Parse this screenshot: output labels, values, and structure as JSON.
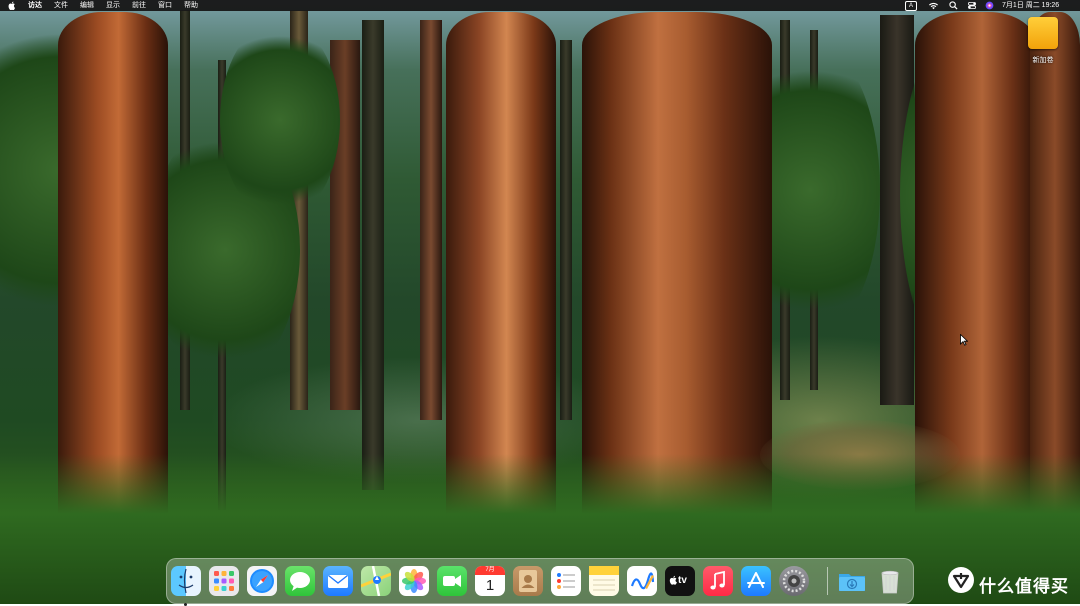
{
  "menubar": {
    "app_name": "访达",
    "menus": [
      "文件",
      "编辑",
      "显示",
      "前往",
      "窗口",
      "帮助"
    ],
    "input_indicator": "A",
    "datetime": "7月1日 周二 19:26"
  },
  "desktop": {
    "icons": [
      {
        "label": "新加卷",
        "icon": "hard-drive-icon"
      }
    ]
  },
  "dock": {
    "apps": [
      {
        "name": "访达",
        "icon": "finder-icon",
        "running": true
      },
      {
        "name": "启动台",
        "icon": "launchpad-icon",
        "running": false
      },
      {
        "name": "Safari浏览器",
        "icon": "safari-icon",
        "running": false
      },
      {
        "name": "信息",
        "icon": "messages-icon",
        "running": false
      },
      {
        "name": "邮件",
        "icon": "mail-icon",
        "running": false
      },
      {
        "name": "地图",
        "icon": "maps-icon",
        "running": false
      },
      {
        "name": "照片",
        "icon": "photos-icon",
        "running": false
      },
      {
        "name": "FaceTime通话",
        "icon": "facetime-icon",
        "running": false
      },
      {
        "name": "日历",
        "icon": "calendar-icon",
        "running": false,
        "month": "7月",
        "day": "1"
      },
      {
        "name": "通讯录",
        "icon": "contacts-icon",
        "running": false
      },
      {
        "name": "提醒事项",
        "icon": "reminders-icon",
        "running": false
      },
      {
        "name": "备忘录",
        "icon": "notes-icon",
        "running": false
      },
      {
        "name": "无边记",
        "icon": "freeform-icon",
        "running": false
      },
      {
        "name": "TV",
        "icon": "apple-tv-icon",
        "running": false,
        "label": "tv"
      },
      {
        "name": "音乐",
        "icon": "music-icon",
        "running": false
      },
      {
        "name": "App Store",
        "icon": "app-store-icon",
        "running": false
      },
      {
        "name": "系统设置",
        "icon": "system-settings-icon",
        "running": false
      },
      {
        "name": "下载",
        "icon": "downloads-folder-icon",
        "running": false
      },
      {
        "name": "废纸篓",
        "icon": "trash-icon",
        "running": false
      }
    ]
  },
  "watermark": {
    "text": "什么值得买",
    "icon": "smzdm-logo-icon"
  }
}
